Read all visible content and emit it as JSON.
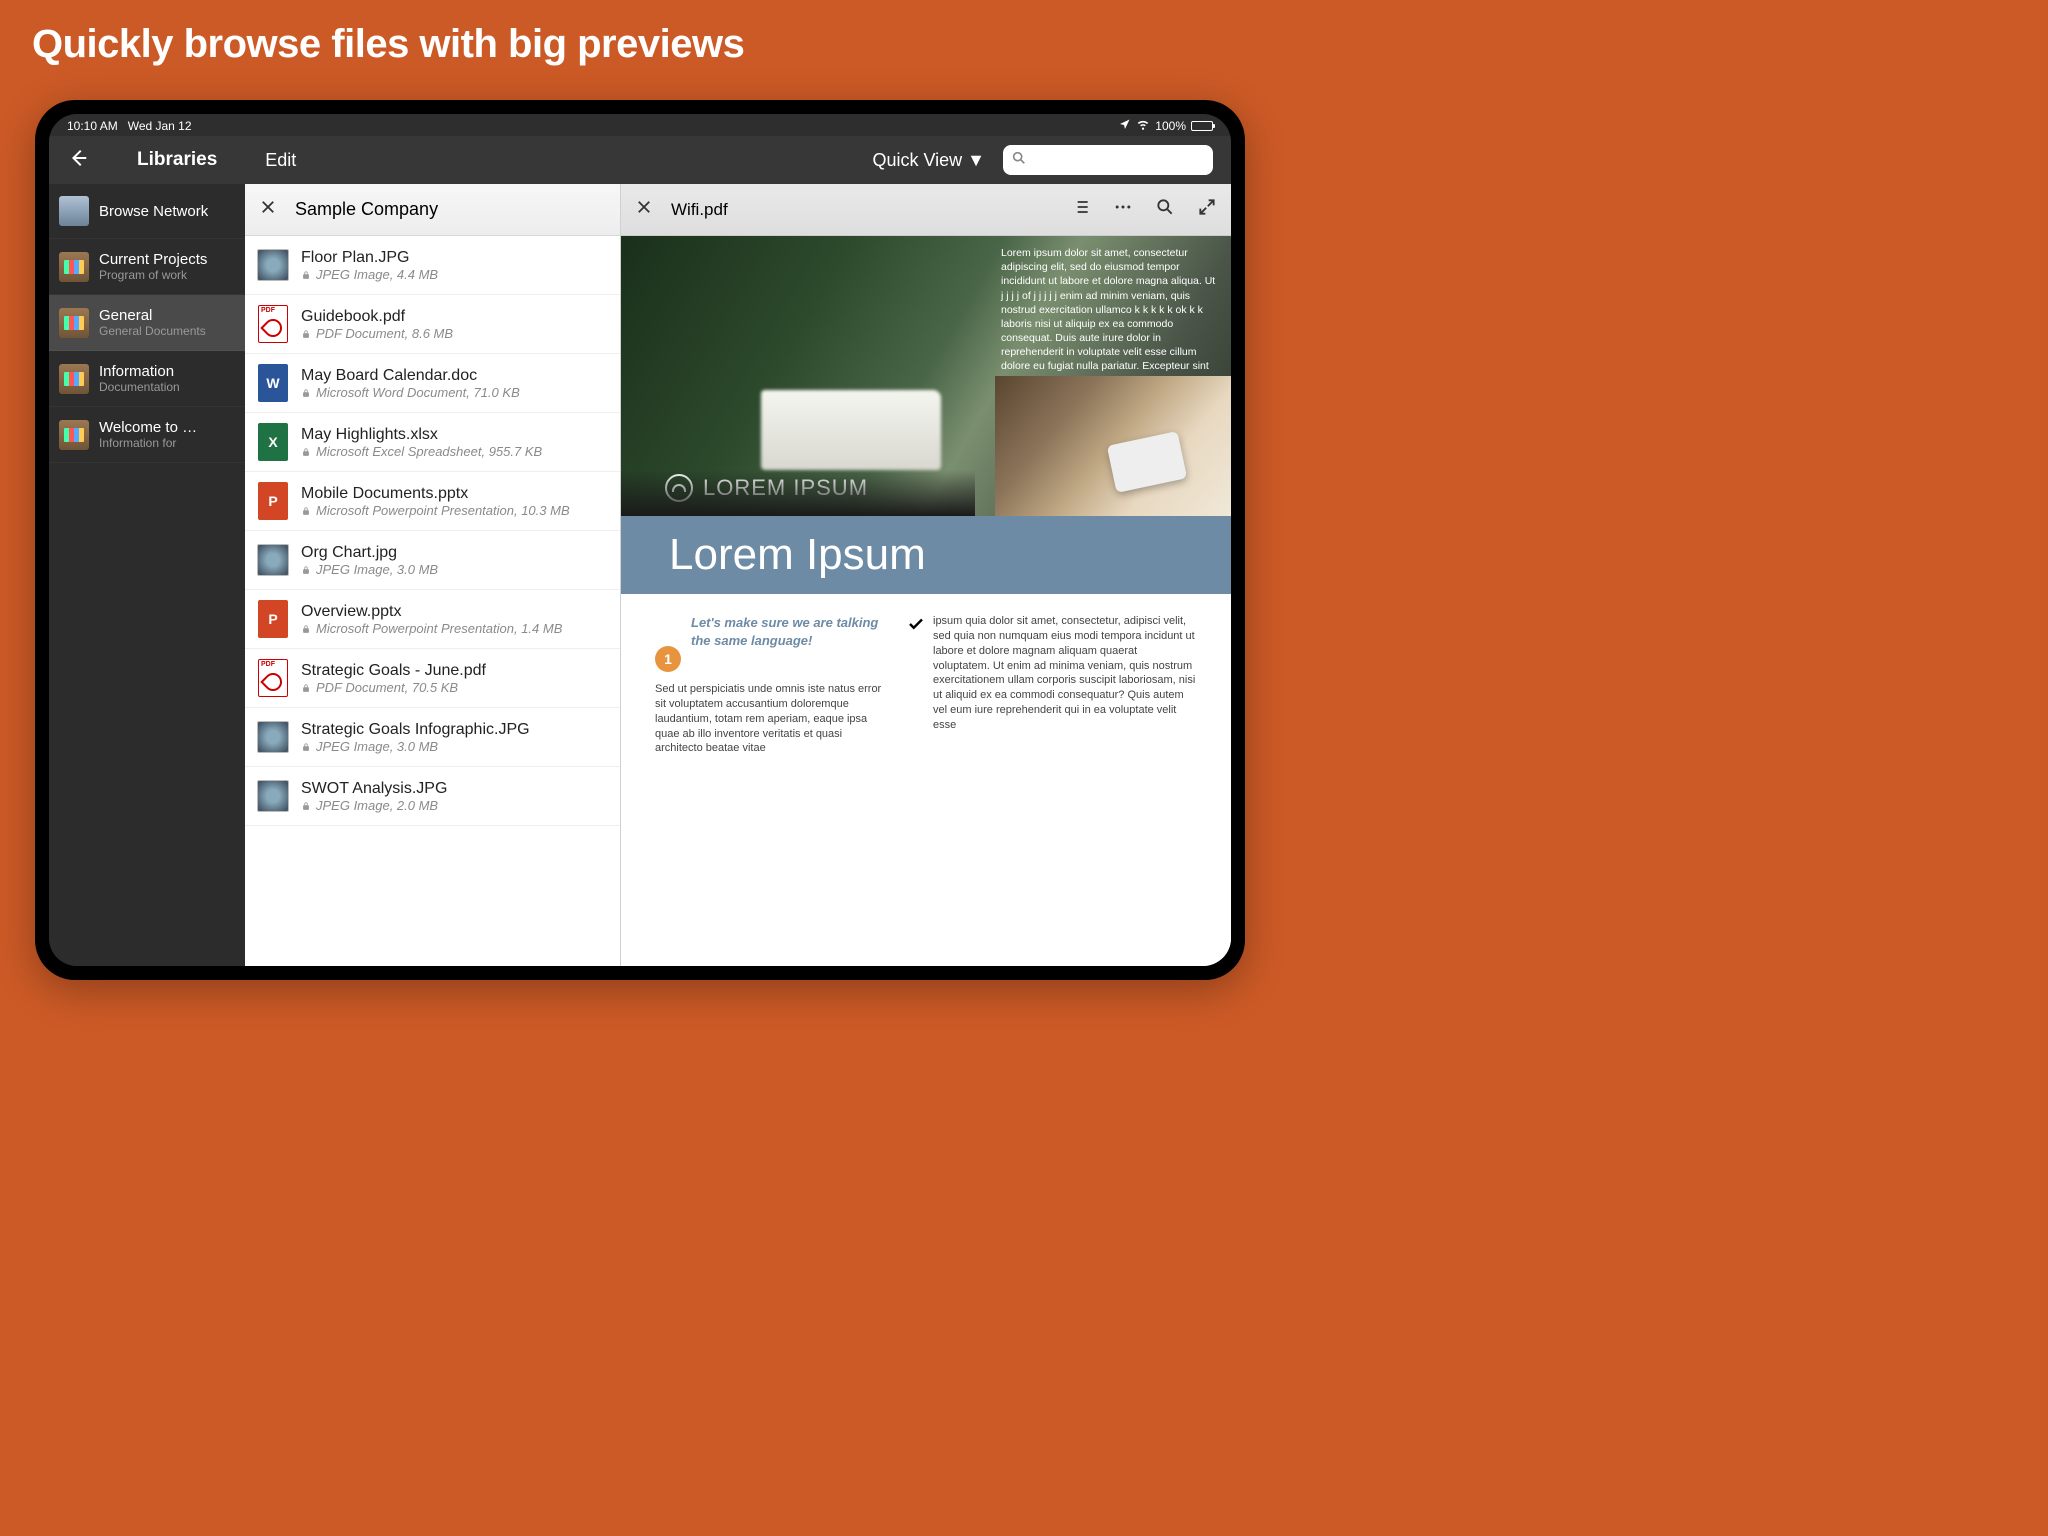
{
  "marketing": {
    "headline": "Quickly browse files with big previews"
  },
  "statusbar": {
    "time": "10:10 AM",
    "date": "Wed Jan 12",
    "battery": "100%"
  },
  "topbar": {
    "title": "Libraries",
    "edit": "Edit",
    "quickview": "Quick View ▼"
  },
  "sidebar": {
    "items": [
      {
        "label": "Browse Network",
        "sub": "",
        "icon": "browse"
      },
      {
        "label": "Current Projects",
        "sub": "Program of work",
        "icon": "shelf"
      },
      {
        "label": "General",
        "sub": "General Documents",
        "icon": "shelf",
        "active": true
      },
      {
        "label": "Information",
        "sub": "Documentation",
        "icon": "shelf"
      },
      {
        "label": "Welcome to …",
        "sub": "Information for",
        "icon": "shelf"
      }
    ]
  },
  "filelist": {
    "title": "Sample Company",
    "files": [
      {
        "name": "Floor Plan.JPG",
        "meta": "JPEG Image, 4.4 MB",
        "type": "jpg"
      },
      {
        "name": "Guidebook.pdf",
        "meta": "PDF Document, 8.6 MB",
        "type": "pdf"
      },
      {
        "name": "May Board Calendar.doc",
        "meta": "Microsoft Word Document, 71.0 KB",
        "type": "word"
      },
      {
        "name": "May Highlights.xlsx",
        "meta": "Microsoft Excel Spreadsheet, 955.7 KB",
        "type": "excel"
      },
      {
        "name": "Mobile Documents.pptx",
        "meta": "Microsoft Powerpoint Presentation, 10.3 MB",
        "type": "ppt"
      },
      {
        "name": "Org Chart.jpg",
        "meta": "JPEG Image, 3.0 MB",
        "type": "jpg"
      },
      {
        "name": "Overview.pptx",
        "meta": "Microsoft Powerpoint Presentation, 1.4 MB",
        "type": "ppt"
      },
      {
        "name": "Strategic Goals - June.pdf",
        "meta": "PDF Document, 70.5 KB",
        "type": "pdf"
      },
      {
        "name": "Strategic Goals Infographic.JPG",
        "meta": "JPEG Image, 3.0 MB",
        "type": "jpg"
      },
      {
        "name": "SWOT Analysis.JPG",
        "meta": "JPEG Image, 2.0 MB",
        "type": "jpg"
      }
    ]
  },
  "preview": {
    "title": "Wifi.pdf",
    "hero_overlay": "Lorem ipsum dolor sit amet, consectetur adipiscing elit, sed do eiusmod tempor incididunt ut labore et dolore magna aliqua. Ut j j j j of  j j j j j enim ad minim veniam, quis nostrud exercitation ullamco k k k k k ok k k  laboris nisi ut aliquip ex ea commodo consequat. Duis aute irure dolor in reprehenderit in voluptate velit esse cillum dolore eu fugiat nulla pariatur. Excepteur sint occaecat",
    "hero_logo": "LOREM IPSUM",
    "bluebar": "Lorem Ipsum",
    "col_left_header": "Let's make sure we are talking the same language!",
    "col_left_num": "1",
    "col_left_body": "Sed ut perspiciatis unde omnis iste natus error sit voluptatem accusantium doloremque laudantium, totam rem aperiam, eaque ipsa quae ab illo inventore veritatis et quasi architecto beatae vitae",
    "col_right_body": "ipsum quia dolor sit amet, consectetur, adipisci velit, sed quia non numquam eius modi tempora incidunt ut labore et dolore magnam aliquam quaerat voluptatem. Ut enim ad minima veniam, quis nostrum exercitationem ullam corporis suscipit laboriosam, nisi ut aliquid ex ea commodi consequatur? Quis autem vel eum iure reprehenderit qui in ea voluptate velit esse"
  }
}
